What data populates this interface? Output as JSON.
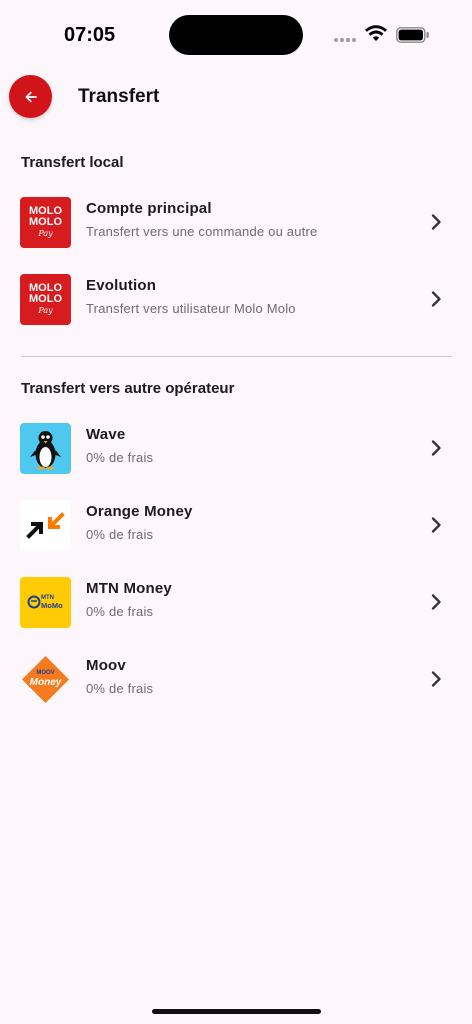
{
  "status_bar": {
    "time": "07:05"
  },
  "header": {
    "title": "Transfert"
  },
  "sections": [
    {
      "title": "Transfert local",
      "items": [
        {
          "title": "Compte principal",
          "subtitle": "Transfert vers une commande ou autre",
          "logo": "molo-molo-pay-logo",
          "logo_text": [
            "MOLO",
            "MOLO",
            "Pay"
          ]
        },
        {
          "title": "Evolution",
          "subtitle": "Transfert vers utilisateur Molo Molo",
          "logo": "molo-molo-pay-logo",
          "logo_text": [
            "MOLO",
            "MOLO",
            "Pay"
          ]
        }
      ]
    },
    {
      "title": "Transfert vers autre opérateur",
      "items": [
        {
          "title": "Wave",
          "subtitle": "0% de frais",
          "logo": "wave-logo"
        },
        {
          "title": "Orange Money",
          "subtitle": "0% de frais",
          "logo": "orange-money-logo"
        },
        {
          "title": "MTN Money",
          "subtitle": "0% de frais",
          "logo": "mtn-momo-logo",
          "logo_text": [
            "MTN",
            "MoMo"
          ]
        },
        {
          "title": "Moov",
          "subtitle": "0% de frais",
          "logo": "moov-money-logo",
          "logo_text": [
            "MOOV",
            "Money"
          ]
        }
      ]
    }
  ],
  "colors": {
    "accent": "#d0141a",
    "background": "#fdf7fc",
    "wave": "#4fc8f0",
    "orange": "#ff7900",
    "mtn": "#ffcb05",
    "moov": "#f47b20"
  },
  "icons": {
    "back": "arrow-left-icon",
    "row_action": "chevron-right-icon"
  }
}
